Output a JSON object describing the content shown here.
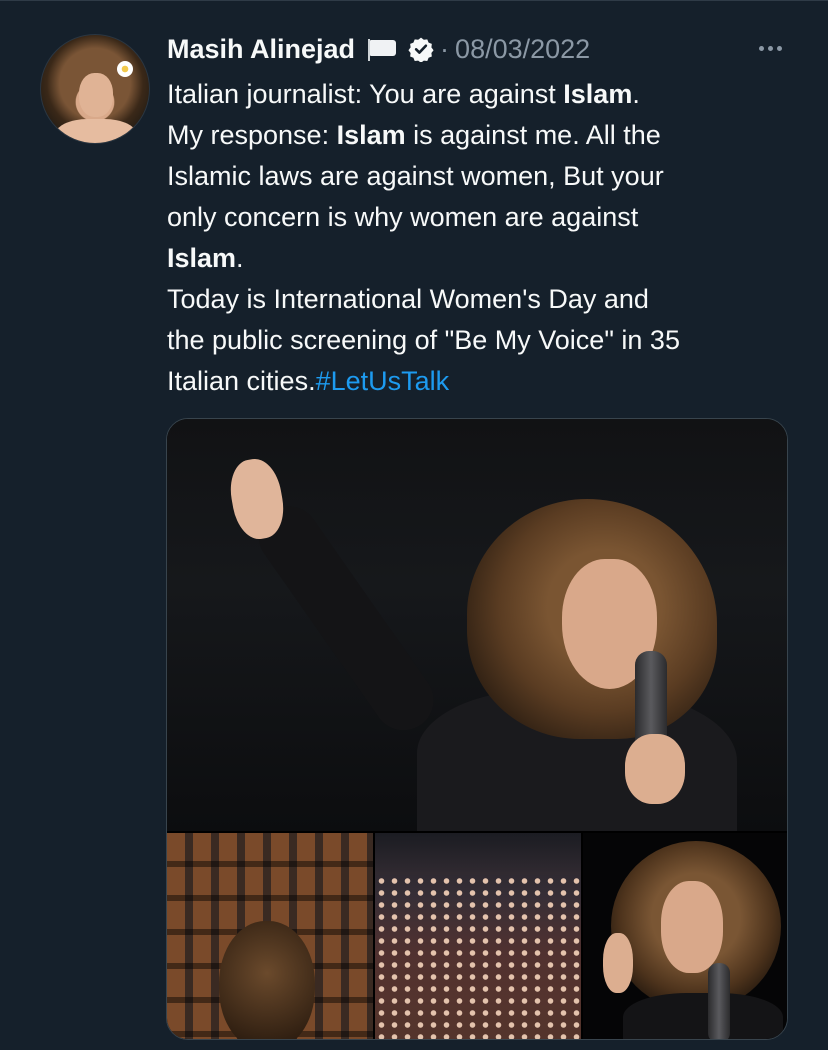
{
  "tweet": {
    "author_name": "Masih Alinejad",
    "flag_icon": "white-flag-icon",
    "verified_icon": "verified-badge-icon",
    "separator": "·",
    "date": "08/03/2022",
    "more_icon": "more-horizontal-icon",
    "text": {
      "l1_a": "Italian journalist: You are against ",
      "l1_b": "Islam",
      "l1_c": ".",
      "l2_a": "My response: ",
      "l2_b": "Islam",
      "l2_c": " is against me. All the",
      "l3": "Islamic laws are against women, But your",
      "l4": "only concern is why women are against",
      "l5_b": "Islam",
      "l5_c": ".",
      "l6": "Today is International Women's Day and",
      "l7": "the public screening of \"Be My Voice\" in 35",
      "l8_a": "Italian cities.",
      "hashtag": "#LetUsTalk"
    },
    "media": {
      "photo_count": 4
    }
  },
  "colors": {
    "background": "#15202b",
    "text_primary": "#f7f9f9",
    "text_secondary": "#8b98a5",
    "link": "#1d9bf0",
    "border": "#38444d"
  }
}
